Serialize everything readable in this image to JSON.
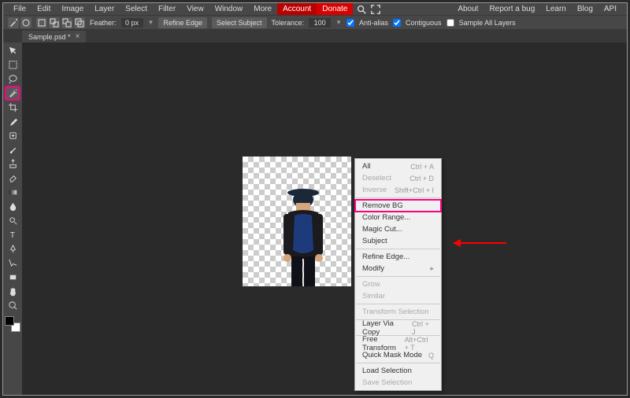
{
  "menubar": {
    "left": [
      "File",
      "Edit",
      "Image",
      "Layer",
      "Select",
      "Filter",
      "View",
      "Window",
      "More"
    ],
    "account": "Account",
    "donate": "Donate",
    "right": [
      "About",
      "Report a bug",
      "Learn",
      "Blog",
      "API"
    ]
  },
  "options": {
    "feather_label": "Feather:",
    "feather_value": "0 px",
    "refine_edge": "Refine Edge",
    "select_subject": "Select Subject",
    "tolerance_label": "Tolerance:",
    "tolerance_value": "100",
    "antialias": "Anti-alias",
    "contiguous": "Contiguous",
    "sample_all": "Sample All Layers"
  },
  "tab": {
    "name": "Sample.psd *"
  },
  "tools": [
    {
      "n": "move-tool"
    },
    {
      "n": "rect-select-tool"
    },
    {
      "n": "lasso-tool"
    },
    {
      "n": "wand-tool",
      "sel": true
    },
    {
      "n": "crop-tool"
    },
    {
      "n": "eyedropper-tool"
    },
    {
      "n": "heal-tool"
    },
    {
      "n": "brush-tool"
    },
    {
      "n": "clone-tool"
    },
    {
      "n": "eraser-tool"
    },
    {
      "n": "gradient-tool"
    },
    {
      "n": "blur-tool"
    },
    {
      "n": "dodge-tool"
    },
    {
      "n": "type-tool"
    },
    {
      "n": "pen-tool"
    },
    {
      "n": "path-tool"
    },
    {
      "n": "rect-tool"
    },
    {
      "n": "hand-tool"
    },
    {
      "n": "zoom-tool"
    }
  ],
  "ctx": [
    {
      "label": "All",
      "short": "Ctrl + A",
      "dis": false
    },
    {
      "label": "Deselect",
      "short": "Ctrl + D",
      "dis": true
    },
    {
      "label": "Inverse",
      "short": "Shift+Ctrl + I",
      "dis": true
    },
    {
      "sep": true
    },
    {
      "label": "Remove BG",
      "hl": true
    },
    {
      "label": "Color Range..."
    },
    {
      "label": "Magic Cut..."
    },
    {
      "label": "Subject"
    },
    {
      "sep": true
    },
    {
      "label": "Refine Edge..."
    },
    {
      "label": "Modify",
      "sub": true
    },
    {
      "sep": true
    },
    {
      "label": "Grow",
      "dis": true
    },
    {
      "label": "Similar",
      "dis": true
    },
    {
      "sep": true
    },
    {
      "label": "Transform Selection",
      "dis": true
    },
    {
      "sep": true
    },
    {
      "label": "Layer Via Copy",
      "short": "Ctrl + J"
    },
    {
      "sep": true
    },
    {
      "label": "Free Transform",
      "short": "Alt+Ctrl + T"
    },
    {
      "label": "Quick Mask Mode",
      "short": "Q"
    },
    {
      "sep": true
    },
    {
      "label": "Load Selection"
    },
    {
      "label": "Save Selection",
      "dis": true
    }
  ]
}
